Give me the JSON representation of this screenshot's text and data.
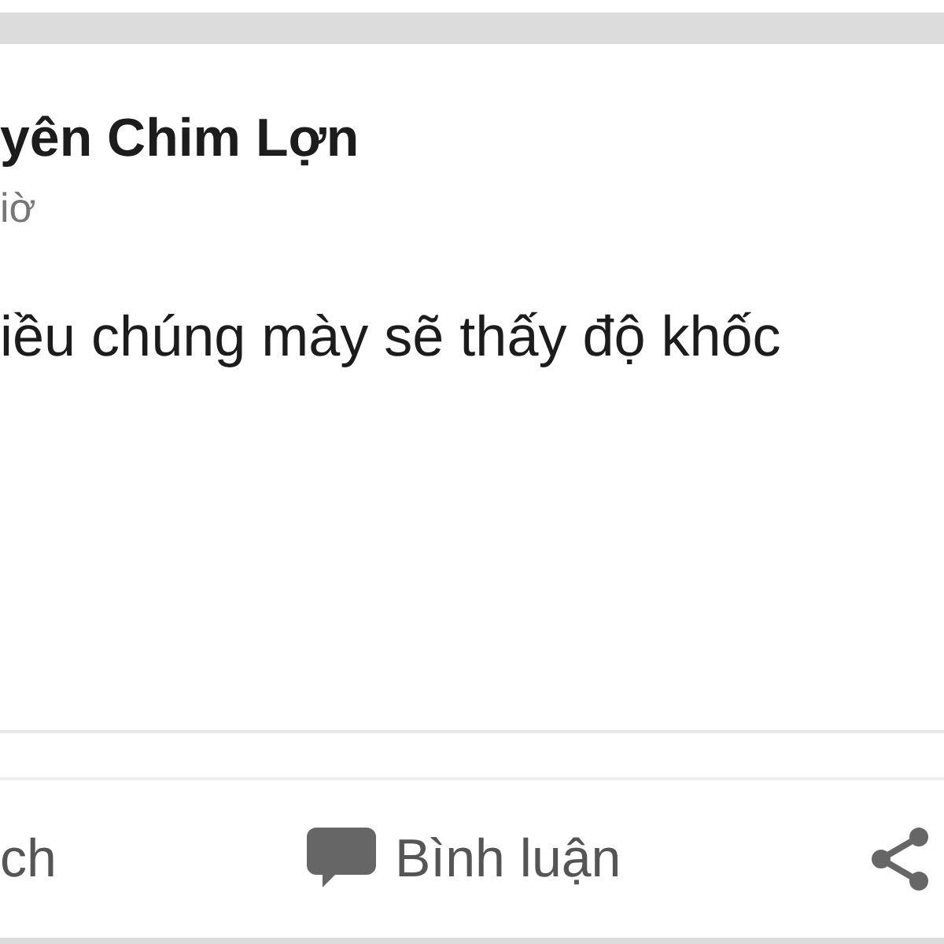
{
  "post": {
    "author": "yên Chim Lợn",
    "time": "iờ",
    "body": "iều chúng mày sẽ thấy độ khốc"
  },
  "actions": [
    {
      "kind": "text",
      "label": "ch"
    },
    {
      "kind": "comment",
      "label": "Bình luận"
    },
    {
      "kind": "share"
    }
  ]
}
